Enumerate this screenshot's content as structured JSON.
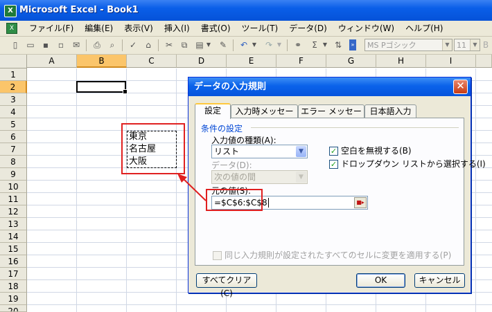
{
  "window": {
    "title": "Microsoft Excel - Book1",
    "accent": "#0a5ee8"
  },
  "menu": [
    "ファイル(F)",
    "編集(E)",
    "表示(V)",
    "挿入(I)",
    "書式(O)",
    "ツール(T)",
    "データ(D)",
    "ウィンドウ(W)",
    "ヘルプ(H)"
  ],
  "toolbar": {
    "font_name": "MS Pゴシック",
    "font_size": "11"
  },
  "grid": {
    "columns": [
      "A",
      "B",
      "C",
      "D",
      "E",
      "F",
      "G",
      "H",
      "I"
    ],
    "rows": [
      "1",
      "2",
      "3",
      "4",
      "5",
      "6",
      "7",
      "8",
      "9",
      "10",
      "11",
      "12",
      "13",
      "14",
      "15",
      "16",
      "17",
      "18",
      "19",
      "20"
    ],
    "selected_column": "B",
    "selected_row": "2",
    "cells": {
      "c6": "東京",
      "c7": "名古屋",
      "c8": "大阪"
    }
  },
  "dialog": {
    "title": "データの入力規則",
    "tabs": [
      "設定",
      "入力時メッセージ",
      "エラー メッセージ",
      "日本語入力"
    ],
    "active_tab": "設定",
    "group_label": "条件の設定",
    "allow_label": "入力値の種類(A):",
    "allow_value": "リスト",
    "data_label": "データ(D):",
    "data_value": "次の値の間",
    "source_label": "元の値(S):",
    "source_value": "=$C$6:$C$8",
    "ignore_blank": {
      "label": "空白を無視する(B)",
      "checked": true
    },
    "in_cell_dropdown": {
      "label": "ドロップダウン リストから選択する(I)",
      "checked": true
    },
    "apply_all": {
      "label": "同じ入力規則が設定されたすべてのセルに変更を適用する(P)",
      "checked": false
    },
    "clear_all_label": "すべてクリア(C)",
    "ok_label": "OK",
    "cancel_label": "キャンセル"
  },
  "annotation_color": "#e02020"
}
